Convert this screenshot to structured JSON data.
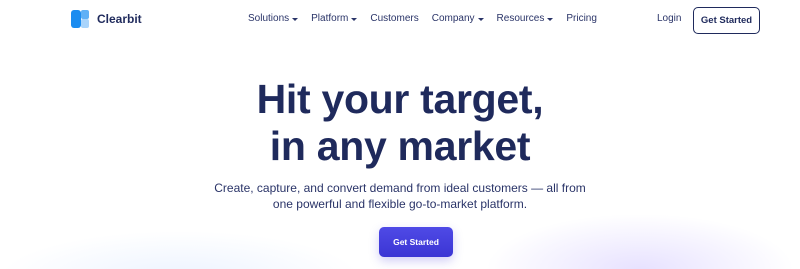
{
  "brand": {
    "name": "Clearbit",
    "logo_icon": "clearbit-logo-icon",
    "colors": {
      "primary": "#1f2a5c",
      "accent": "#4f4ae6",
      "logo_dark": "#1a8cf0",
      "logo_light": "#a9d4fb"
    }
  },
  "nav": {
    "items": [
      {
        "label": "Solutions",
        "has_dropdown": true
      },
      {
        "label": "Platform",
        "has_dropdown": true
      },
      {
        "label": "Customers",
        "has_dropdown": false
      },
      {
        "label": "Company",
        "has_dropdown": true
      },
      {
        "label": "Resources",
        "has_dropdown": true
      },
      {
        "label": "Pricing",
        "has_dropdown": false
      }
    ],
    "login_label": "Login",
    "cta_label": "Get Started"
  },
  "hero": {
    "title_line1": "Hit your target,",
    "title_line2": "in any market",
    "subtitle_line1": "Create, capture, and convert demand from ideal customers — all from",
    "subtitle_line2": "one powerful and flexible go-to-market platform.",
    "cta_label": "Get Started"
  }
}
